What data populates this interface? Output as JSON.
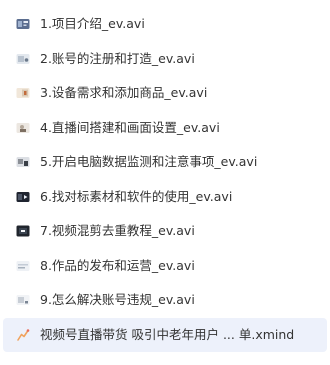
{
  "files": [
    {
      "name": "1.项目介绍_ev.avi",
      "icon": "video-thumbnail-icon",
      "thumb_color": "#5b6d8f"
    },
    {
      "name": "2.账号的注册和打造_ev.avi",
      "icon": "video-thumbnail-icon",
      "thumb_color": "#b9c3cf"
    },
    {
      "name": "3.设备需求和添加商品_ev.avi",
      "icon": "video-thumbnail-icon",
      "thumb_color": "#d9c8b4"
    },
    {
      "name": "4.直播间搭建和画面设置_ev.avi",
      "icon": "video-thumbnail-icon",
      "thumb_color": "#b3a79a"
    },
    {
      "name": "5.开启电脑数据监测和注意事项_ev.avi",
      "icon": "video-thumbnail-icon",
      "thumb_color": "#8b8f96"
    },
    {
      "name": "6.找对标素材和软件的使用_ev.avi",
      "icon": "video-thumbnail-icon",
      "thumb_color": "#1f2430"
    },
    {
      "name": "7.视频混剪去重教程_ev.avi",
      "icon": "video-thumbnail-icon",
      "thumb_color": "#20252d"
    },
    {
      "name": "8.作品的发布和运营_ev.avi",
      "icon": "video-thumbnail-icon",
      "thumb_color": "#c4ccd6"
    },
    {
      "name": "9.怎么解决账号违规_ev.avi",
      "icon": "video-thumbnail-icon",
      "thumb_color": "#c8ced6"
    },
    {
      "name": "视频号直播带货 吸引中老年用户 ...   单.xmind",
      "icon": "mindmap-file-icon",
      "thumb_color": "#f0a35e"
    }
  ],
  "selected_index": 9,
  "colors": {
    "text": "#333333",
    "selected_background": "#edf1fb"
  }
}
